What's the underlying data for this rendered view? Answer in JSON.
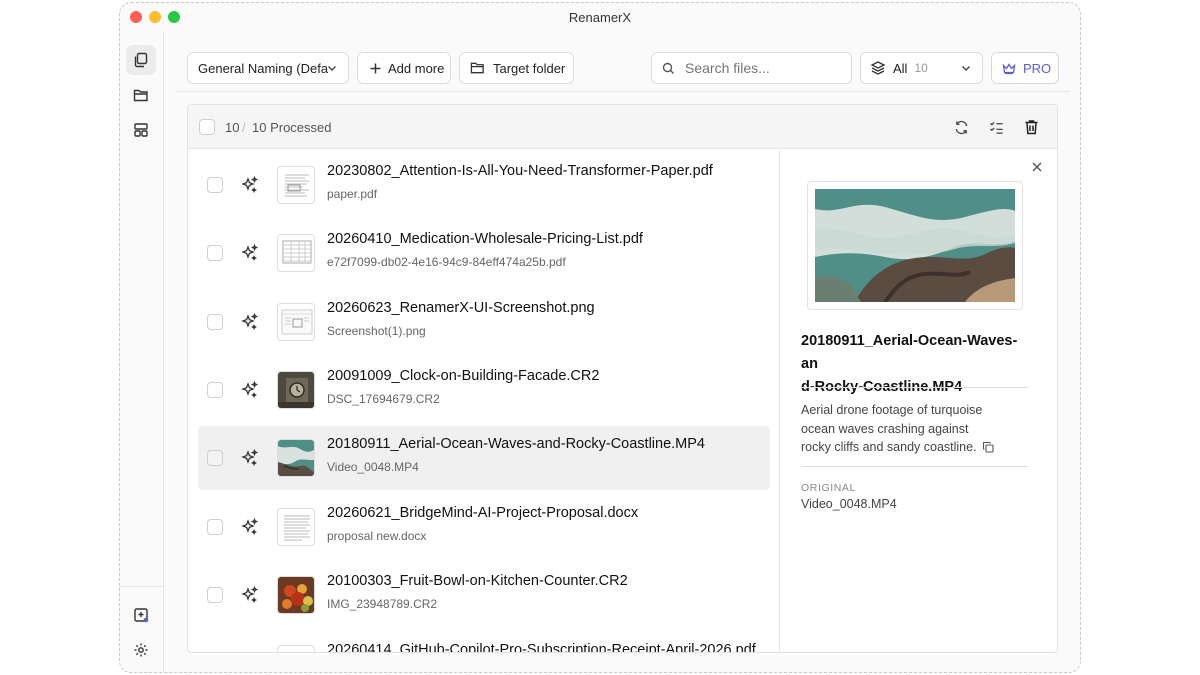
{
  "app": {
    "title": "RenamerX"
  },
  "toolbar": {
    "preset_label": "General Naming (Defa",
    "add_more_label": "Add more",
    "target_folder_label": "Target folder",
    "search_placeholder": "Search files...",
    "filter_label": "All",
    "filter_count": "10",
    "pro_label": "PRO"
  },
  "list_header": {
    "selected_count": "10",
    "separator": "/",
    "processed_label": "10 Processed"
  },
  "files": [
    {
      "name": "20230802_Attention-Is-All-You-Need-Transformer-Paper.pdf",
      "original": "paper.pdf",
      "thumb": "document"
    },
    {
      "name": "20260410_Medication-Wholesale-Pricing-List.pdf",
      "original": "e72f7099-db02-4e16-94c9-84eff474a25b.pdf",
      "thumb": "table"
    },
    {
      "name": "20260623_RenamerX-UI-Screenshot.png",
      "original": "Screenshot(1).png",
      "thumb": "screenshot"
    },
    {
      "name": "20091009_Clock-on-Building-Facade.CR2",
      "original": "DSC_17694679.CR2",
      "thumb": "photo-clock"
    },
    {
      "name": "20180911_Aerial-Ocean-Waves-and-Rocky-Coastline.MP4",
      "original": "Video_0048.MP4",
      "thumb": "photo-ocean"
    },
    {
      "name": "20260621_BridgeMind-AI-Project-Proposal.docx",
      "original": "proposal new.docx",
      "thumb": "document"
    },
    {
      "name": "20100303_Fruit-Bowl-on-Kitchen-Counter.CR2",
      "original": "IMG_23948789.CR2",
      "thumb": "photo-fruit"
    },
    {
      "name": "20260414_GitHub-Copilot-Pro-Subscription-Receipt-April-2026.pdf",
      "original": "",
      "thumb": "document"
    }
  ],
  "detail": {
    "title": "20180911_Aerial-Ocean-Waves-and-Rocky-Coastline.MP4",
    "title_line1": "20180911_Aerial-Ocean-Waves-an",
    "title_line2": "d-Rocky-Coastline.MP4",
    "description_line1": "Aerial drone footage of turquoise",
    "description_line2": "ocean waves crashing against",
    "description_line3": "rocky cliffs and sandy coastline.",
    "original_label": "ORIGINAL",
    "original_value": "Video_0048.MP4"
  },
  "colors": {
    "accent": "#5a5fd6",
    "selected_row": "#f0f0f0",
    "close_red": "#ff5f57",
    "minimize_yellow": "#febc2e",
    "zoom_green": "#28c840"
  },
  "icons": {
    "sidebar": [
      "files-icon",
      "folder-icon",
      "templates-icon",
      "preview-icon",
      "gear-icon"
    ],
    "toolbar": [
      "chevron-down-icon",
      "plus-icon",
      "folder-icon",
      "search-icon",
      "layers-icon",
      "crown-icon"
    ],
    "list_header": [
      "refresh-icon",
      "checklist-icon",
      "trash-icon"
    ]
  }
}
